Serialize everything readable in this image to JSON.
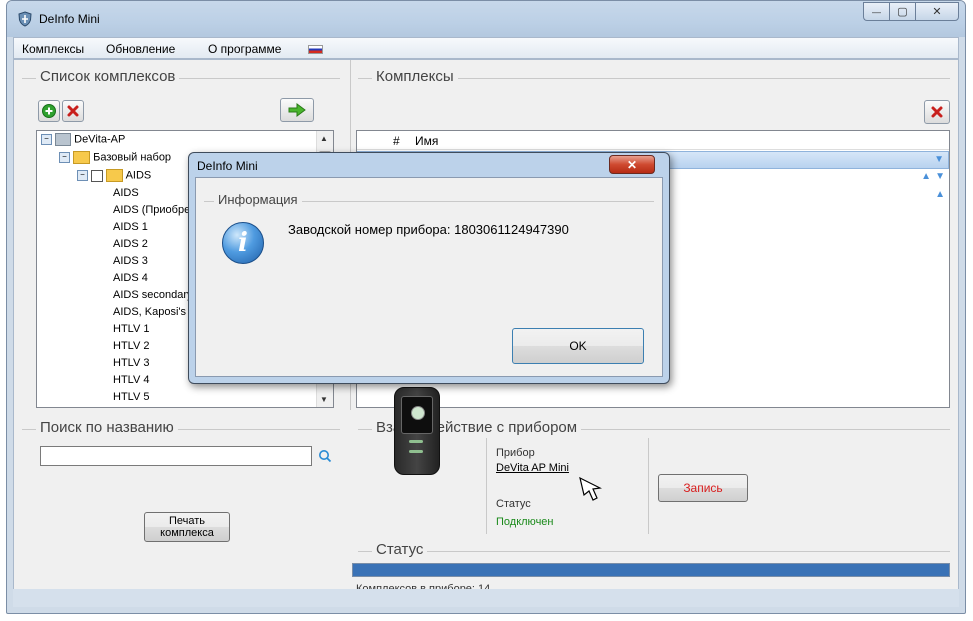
{
  "window": {
    "title": "DeInfo Mini",
    "minimize_icon": "—",
    "maximize_icon": "▢",
    "close_icon": "✕"
  },
  "menu": {
    "items": [
      "Комплексы",
      "Обновление",
      "О программе"
    ],
    "language_flag": "russian-flag"
  },
  "complex_list": {
    "heading": "Список комплексов",
    "add_icon": "✖",
    "tree": [
      {
        "label": "DeVita-AP",
        "level": 0,
        "icon": "device"
      },
      {
        "label": "Базовый набор",
        "level": 1,
        "icon": "folder"
      },
      {
        "label": "AIDS",
        "level": 2,
        "icon": "folder-checkbox"
      },
      {
        "label": "AIDS",
        "level": 3
      },
      {
        "label": "AIDS  (Приобре",
        "level": 3
      },
      {
        "label": "AIDS 1",
        "level": 3
      },
      {
        "label": "AIDS 2",
        "level": 3
      },
      {
        "label": "AIDS 3",
        "level": 3
      },
      {
        "label": "AIDS 4",
        "level": 3
      },
      {
        "label": "AIDS secondary",
        "level": 3
      },
      {
        "label": "AIDS, Kaposi's",
        "level": 3
      },
      {
        "label": "HTLV 1",
        "level": 3
      },
      {
        "label": "HTLV 2",
        "level": 3
      },
      {
        "label": "HTLV 3",
        "level": 3
      },
      {
        "label": "HTLV 4",
        "level": 3
      },
      {
        "label": "HTLV 5",
        "level": 3
      }
    ]
  },
  "complexes": {
    "heading": "Комплексы",
    "columns": [
      "#",
      "Имя"
    ],
    "accent": "#4a90d9"
  },
  "search": {
    "heading": "Поиск по названию",
    "value": "",
    "print_button_line1": "Печать",
    "print_button_line2": "комплекса"
  },
  "device": {
    "heading": "Взаимодействие с прибором",
    "device_label": "Прибор",
    "device_name": "DeVita AP Mini",
    "status_label": "Статус",
    "status_value": "Подключен",
    "status_color": "#1a8a1a",
    "write_button": "Запись",
    "write_color": "#d81e1e"
  },
  "status": {
    "heading": "Статус",
    "text": "Комплексов в приборе: 14",
    "progress": 1.0
  },
  "dialog": {
    "title": "DeInfo Mini",
    "group": "Информация",
    "message": "Заводской номер прибора: 1803061124947390",
    "ok_button": "OK",
    "icon": "info-icon",
    "close_icon": "✕"
  }
}
